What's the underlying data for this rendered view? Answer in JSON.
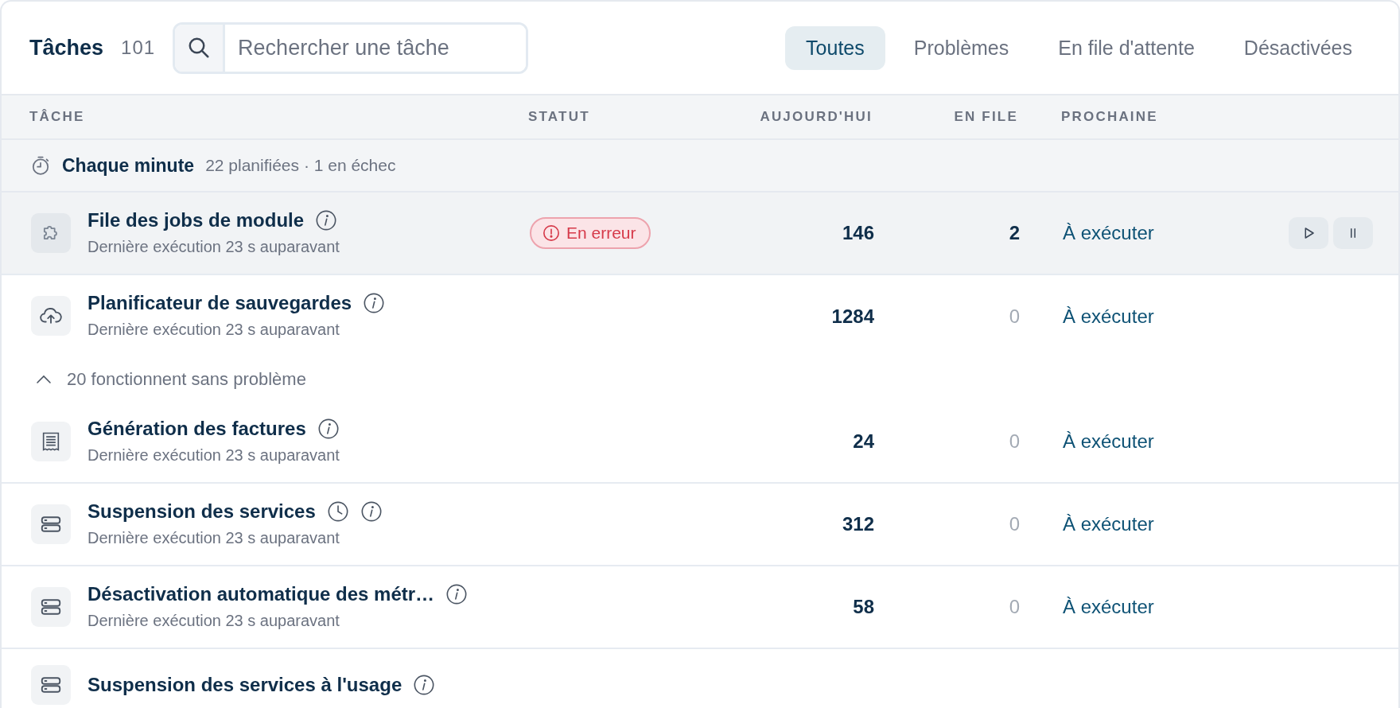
{
  "header": {
    "title": "Tâches",
    "count": "101",
    "search": {
      "placeholder": "Rechercher une tâche"
    }
  },
  "tabs": [
    {
      "label": "Toutes",
      "selected": true
    },
    {
      "label": "Problèmes",
      "selected": false
    },
    {
      "label": "En file d'attente",
      "selected": false
    },
    {
      "label": "Désactivées",
      "selected": false
    }
  ],
  "table": {
    "columns": [
      "TÂCHE",
      "STATUT",
      "AUJOURD'HUI",
      "EN FILE",
      "PROCHAINE"
    ],
    "group": {
      "title": "Chaque minute",
      "summary": "22 planifiées · 1 en échec"
    },
    "rows": [
      {
        "kind": "task",
        "title": "File des jobs de module",
        "subtitle": "Dernière exécution 23 s auparavant",
        "status": {
          "label": "En erreur",
          "kind": "error"
        },
        "today": "146",
        "queued": "2",
        "queued_active": true,
        "next": "À exécuter",
        "hovered": true,
        "scheduled": false
      },
      {
        "kind": "task",
        "title": "Planificateur de sauvegardes",
        "subtitle": "Dernière exécution 23 s auparavant",
        "today": "1284",
        "queued": "0",
        "queued_active": false,
        "next": "À exécuter",
        "hovered": false,
        "scheduled": false,
        "divider": false
      },
      {
        "kind": "collapse",
        "label": "20 fonctionnent sans problème",
        "expanded": true
      },
      {
        "kind": "task",
        "title": "Génération des factures",
        "subtitle": "Dernière exécution 23 s auparavant",
        "today": "24",
        "queued": "0",
        "queued_active": false,
        "next": "À exécuter",
        "hovered": false,
        "scheduled": false
      },
      {
        "kind": "task",
        "title": "Suspension des services",
        "subtitle": "Dernière exécution 23 s auparavant",
        "today": "312",
        "queued": "0",
        "queued_active": false,
        "next": "À exécuter",
        "hovered": false,
        "scheduled": true
      },
      {
        "kind": "task",
        "title": "Désactivation automatique des métr…",
        "subtitle": "Dernière exécution 23 s auparavant",
        "today": "58",
        "queued": "0",
        "queued_active": false,
        "next": "À exécuter",
        "hovered": false,
        "scheduled": false
      },
      {
        "kind": "task",
        "title": "Suspension des services à l'usage",
        "hovered": false,
        "scheduled": false
      }
    ]
  }
}
